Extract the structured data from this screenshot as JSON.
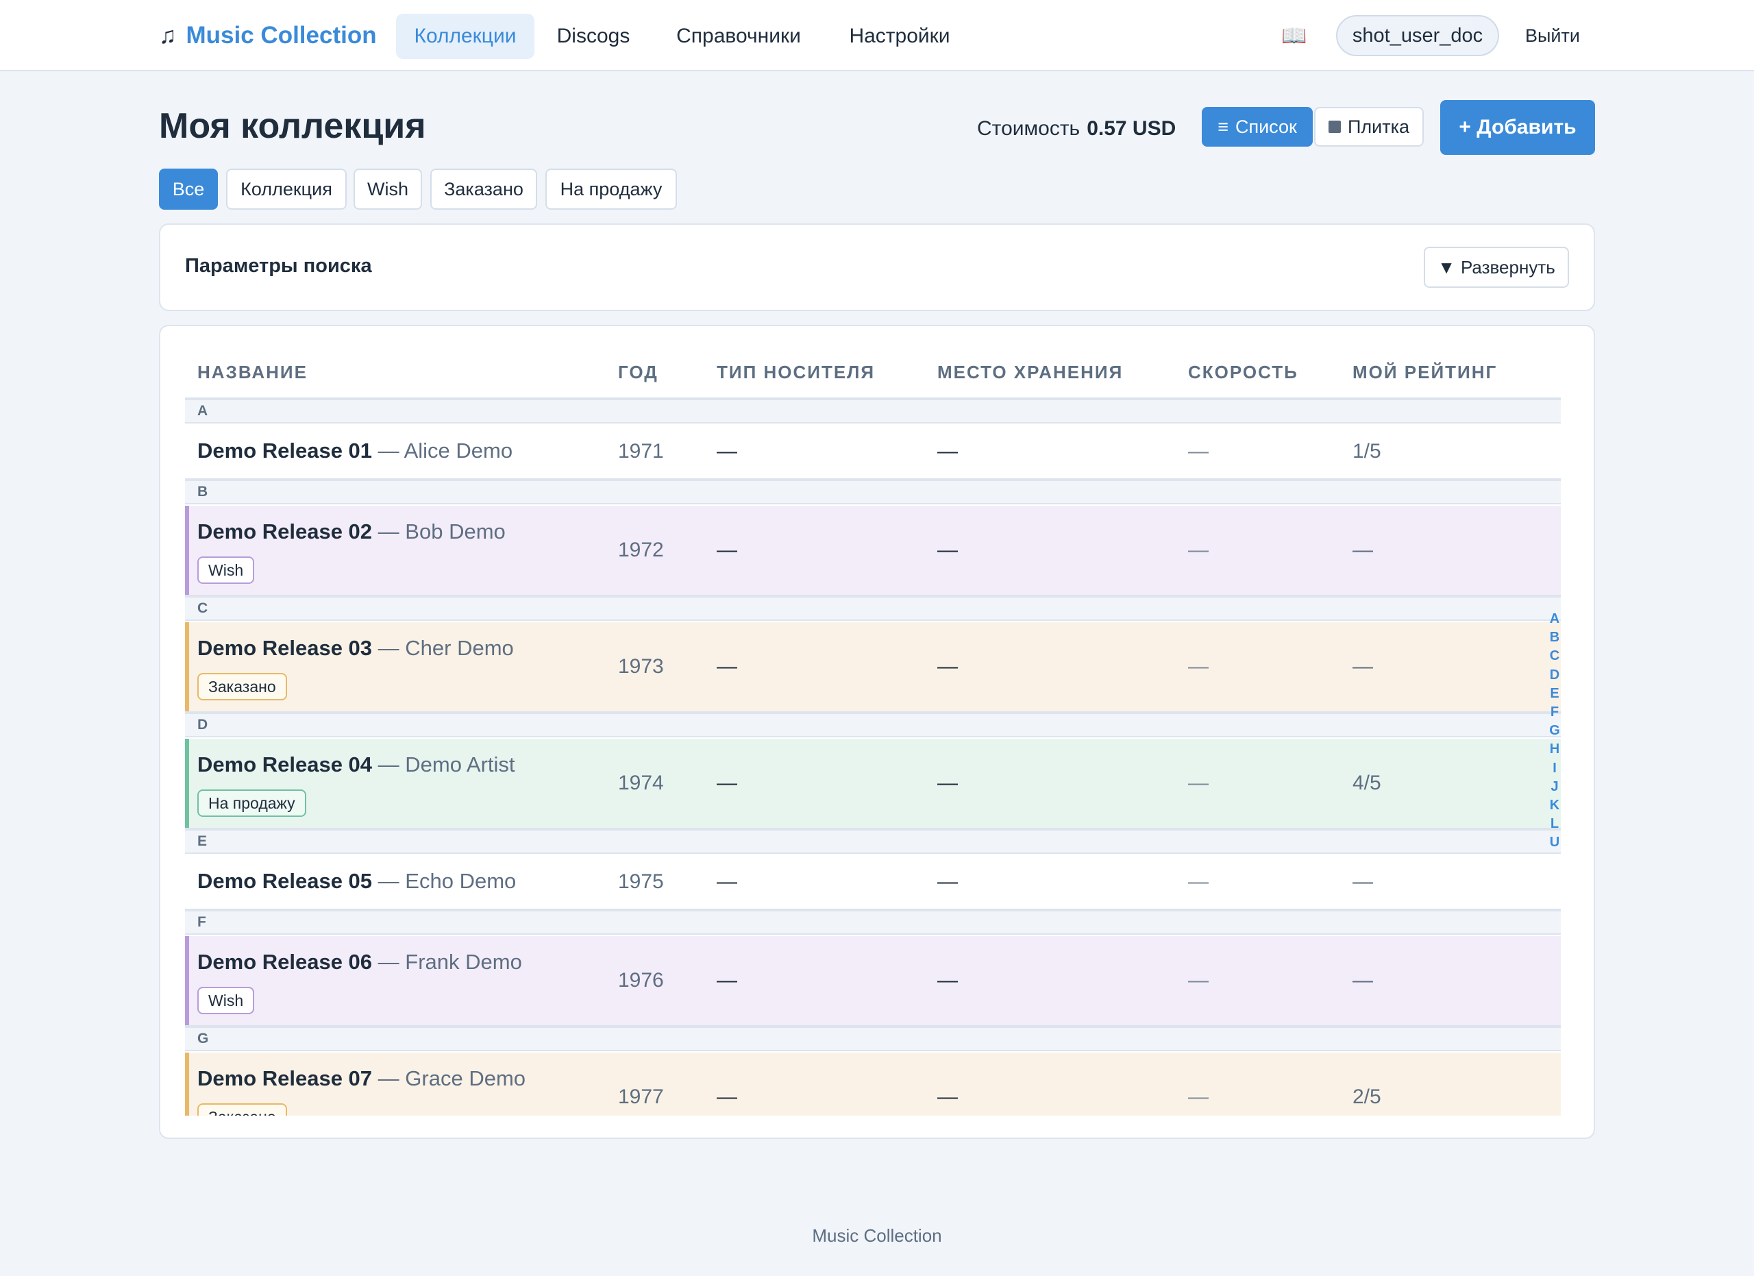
{
  "nav": {
    "brand": "Music Collection",
    "brand_icon": "music-note-icon",
    "items": [
      {
        "label": "Коллекции",
        "active": true
      },
      {
        "label": "Discogs",
        "active": false
      },
      {
        "label": "Справочники",
        "active": false
      },
      {
        "label": "Настройки",
        "active": false
      }
    ],
    "help_icon": "📖",
    "user": "shot_user_doc",
    "logout": "Выйти"
  },
  "header": {
    "title": "Моя коллекция",
    "cost_label": "Стоимость",
    "cost_value": "0.57 USD",
    "view_list_icon": "≡",
    "view_list": "Список",
    "view_tile": "Плитка",
    "add": "+ Добавить"
  },
  "filters": [
    {
      "label": "Все",
      "active": true
    },
    {
      "label": "Коллекция",
      "active": false
    },
    {
      "label": "Wish",
      "active": false
    },
    {
      "label": "Заказано",
      "active": false
    },
    {
      "label": "На продажу",
      "active": false
    }
  ],
  "search": {
    "title": "Параметры поиска",
    "expand_icon": "▼",
    "expand": "Развернуть"
  },
  "table": {
    "columns": [
      "Название",
      "Год",
      "Тип носителя",
      "Место хранения",
      "Скорость",
      "Мой рейтинг"
    ],
    "separator": "—",
    "groups": [
      {
        "letter": "A",
        "rows": [
          {
            "title": "Demo Release 01",
            "artist": "Alice Demo",
            "year": "1971",
            "media": "—",
            "storage": "—",
            "speed": "—",
            "rating": "1/5",
            "status": ""
          }
        ]
      },
      {
        "letter": "B",
        "rows": [
          {
            "title": "Demo Release 02",
            "artist": "Bob Demo",
            "year": "1972",
            "media": "—",
            "storage": "—",
            "speed": "—",
            "rating": "—",
            "status": "wish",
            "badge": "Wish"
          }
        ]
      },
      {
        "letter": "C",
        "rows": [
          {
            "title": "Demo Release 03",
            "artist": "Cher Demo",
            "year": "1973",
            "media": "—",
            "storage": "—",
            "speed": "—",
            "rating": "—",
            "status": "ordered",
            "badge": "Заказано"
          }
        ]
      },
      {
        "letter": "D",
        "rows": [
          {
            "title": "Demo Release 04",
            "artist": "Demo Artist",
            "year": "1974",
            "media": "—",
            "storage": "—",
            "speed": "—",
            "rating": "4/5",
            "status": "sale",
            "badge": "На продажу"
          }
        ]
      },
      {
        "letter": "E",
        "rows": [
          {
            "title": "Demo Release 05",
            "artist": "Echo Demo",
            "year": "1975",
            "media": "—",
            "storage": "—",
            "speed": "—",
            "rating": "—",
            "status": ""
          }
        ]
      },
      {
        "letter": "F",
        "rows": [
          {
            "title": "Demo Release 06",
            "artist": "Frank Demo",
            "year": "1976",
            "media": "—",
            "storage": "—",
            "speed": "—",
            "rating": "—",
            "status": "wish",
            "badge": "Wish"
          }
        ]
      },
      {
        "letter": "G",
        "rows": [
          {
            "title": "Demo Release 07",
            "artist": "Grace Demo",
            "year": "1977",
            "media": "—",
            "storage": "—",
            "speed": "—",
            "rating": "2/5",
            "status": "ordered",
            "badge": "Заказано"
          }
        ]
      }
    ]
  },
  "alphabet_index": [
    "A",
    "B",
    "C",
    "D",
    "E",
    "F",
    "G",
    "H",
    "I",
    "J",
    "K",
    "L",
    "U"
  ],
  "footer": "Music Collection",
  "colors": {
    "accent": "#3a8ad9",
    "wish": "#b89bdb",
    "ordered": "#e8b968",
    "sale": "#6fc2a0"
  }
}
